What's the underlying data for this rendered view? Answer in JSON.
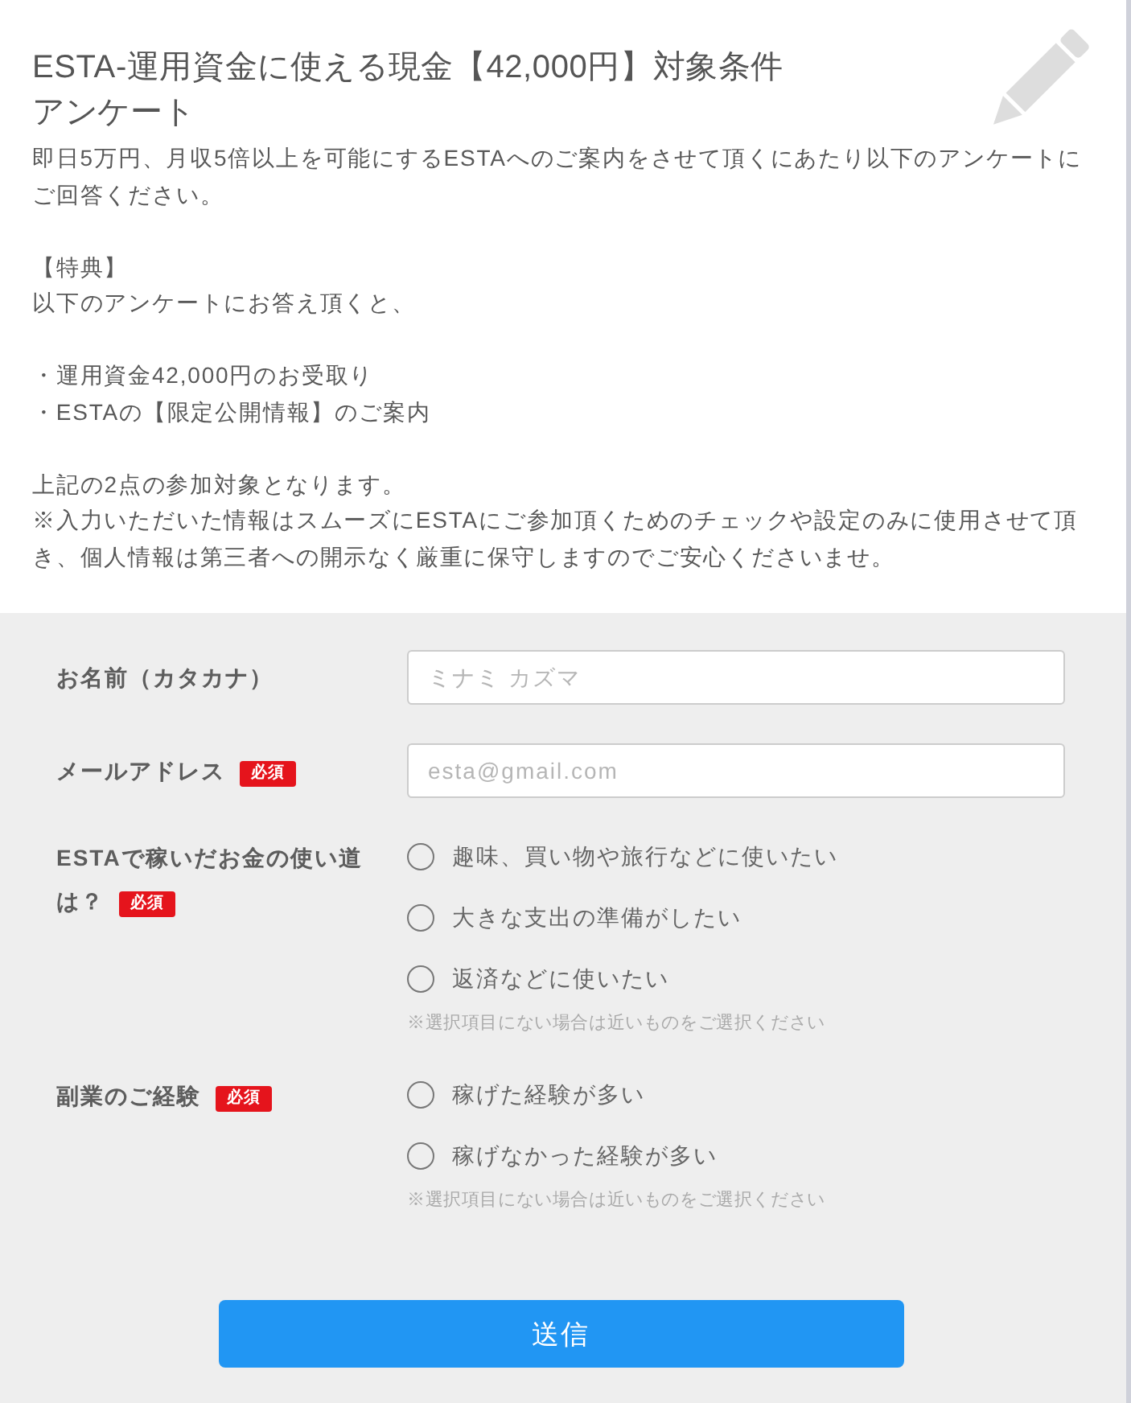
{
  "header": {
    "title": "ESTA-運用資金に使える現金【42,000円】対象条件アンケート",
    "intro": [
      {
        "lines": [
          "即日5万円、月収5倍以上を可能にするESTAへのご案内をさせて頂くにあたり以下のアンケートにご回答ください。"
        ]
      },
      {
        "lines": [
          "【特典】",
          "以下のアンケートにお答え頂くと、"
        ]
      },
      {
        "lines": [
          "・運用資金42,000円のお受取り",
          "・ESTAの【限定公開情報】のご案内"
        ]
      },
      {
        "lines": [
          "上記の2点の参加対象となります。",
          "※入力いただいた情報はスムーズにESTAにご参加頂くためのチェックや設定のみに使用させて頂き、個人情報は第三者への開示なく厳重に保守しますのでご安心くださいませ。"
        ]
      }
    ]
  },
  "form": {
    "fields": [
      {
        "kind": "text",
        "label_lines": [
          "お名前（カタカナ）"
        ],
        "placeholder": "ミナミ カズマ"
      },
      {
        "kind": "text",
        "label_lines": [
          "メールアドレス"
        ],
        "badge": "必須",
        "placeholder": "esta@gmail.com"
      },
      {
        "kind": "radio",
        "label_lines": [
          "ESTAで稼いだお金の使い道",
          "は？"
        ],
        "badge": "必須",
        "options": [
          {
            "label": "趣味、買い物や旅行などに使いたい",
            "selected": false
          },
          {
            "label": "大きな支出の準備がしたい",
            "selected": false
          },
          {
            "label": "返済などに使いたい",
            "selected": false
          }
        ],
        "note": "※選択項目にない場合は近いものをご選択ください"
      },
      {
        "kind": "radio",
        "label_lines": [
          "副業のご経験"
        ],
        "badge": "必須",
        "options": [
          {
            "label": "稼げた経験が多い",
            "selected": false
          },
          {
            "label": "稼げなかった経験が多い",
            "selected": false
          }
        ],
        "note": "※選択項目にない場合は近いものをご選択ください"
      }
    ],
    "submit_button": "送信"
  }
}
